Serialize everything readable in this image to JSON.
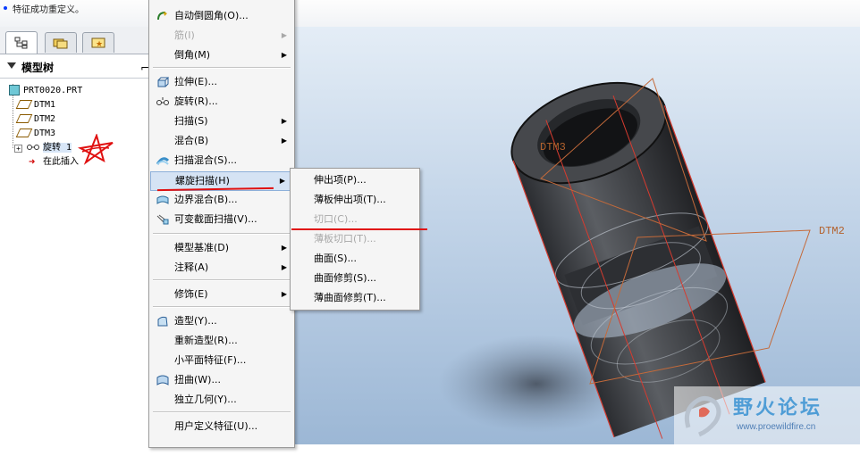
{
  "message_bar": {
    "text": "特征成功重定义。"
  },
  "navigator": {
    "tabs": [
      {
        "name": "model-tree-tab"
      },
      {
        "name": "folder-browser-tab"
      },
      {
        "name": "favorites-tab"
      }
    ],
    "header": {
      "title": "模型树"
    },
    "tree": [
      {
        "label": "PRT0020.PRT",
        "icon": "part-icon"
      },
      {
        "label": "DTM1",
        "icon": "datum-plane-icon"
      },
      {
        "label": "DTM2",
        "icon": "datum-plane-icon"
      },
      {
        "label": "DTM3",
        "icon": "datum-plane-icon"
      },
      {
        "label": "旋转 1",
        "icon": "revolve-icon",
        "expand": "+"
      },
      {
        "label": "在此插入",
        "icon": "insert-here-icon"
      }
    ]
  },
  "context_menu": {
    "items": [
      {
        "label": "",
        "type": "item"
      },
      {
        "label": "自动倒圆角(O)...",
        "icon": "auto-round-icon"
      },
      {
        "label": "筋(I)",
        "disabled": true,
        "submenu": true
      },
      {
        "label": "倒角(M)",
        "submenu": true
      },
      {
        "label": "拉伸(E)...",
        "icon": "extrude-icon"
      },
      {
        "label": "旋转(R)...",
        "icon": "revolve-icon"
      },
      {
        "label": "扫描(S)",
        "submenu": true
      },
      {
        "label": "混合(B)",
        "submenu": true
      },
      {
        "label": "扫描混合(S)...",
        "icon": "swept-blend-icon"
      },
      {
        "label": "螺旋扫描(H)",
        "submenu": true,
        "hover": true
      },
      {
        "label": "边界混合(B)...",
        "icon": "boundary-blend-icon"
      },
      {
        "label": "可变截面扫描(V)...",
        "icon": "variable-sweep-icon"
      },
      {
        "label": "模型基准(D)",
        "submenu": true
      },
      {
        "label": "注释(A)",
        "submenu": true
      },
      {
        "label": "修饰(E)",
        "submenu": true
      },
      {
        "label": "造型(Y)...",
        "icon": "style-icon"
      },
      {
        "label": "重新造型(R)..."
      },
      {
        "label": "小平面特征(F)..."
      },
      {
        "label": "扭曲(W)...",
        "icon": "warp-icon"
      },
      {
        "label": "独立几何(Y)..."
      },
      {
        "label": "用户定义特征(U)..."
      },
      {
        "label": ""
      }
    ]
  },
  "submenu": {
    "items": [
      {
        "label": "伸出项(P)..."
      },
      {
        "label": "薄板伸出项(T)..."
      },
      {
        "label": "切口(C)...",
        "disabled": true
      },
      {
        "label": "薄板切口(T)...",
        "disabled": true
      },
      {
        "label": "曲面(S)..."
      },
      {
        "label": "曲面修剪(S)..."
      },
      {
        "label": "薄曲面修剪(T)..."
      }
    ]
  },
  "viewport": {
    "datum_labels": {
      "dtm3": "DTM3",
      "dtm2": "DTM2"
    }
  },
  "watermark": {
    "title": "野火论坛",
    "url": "www.proewildfire.cn"
  },
  "colors": {
    "accent": "#d5e3f4",
    "annotation_red": "#e01010",
    "datum": "#b3622d"
  }
}
